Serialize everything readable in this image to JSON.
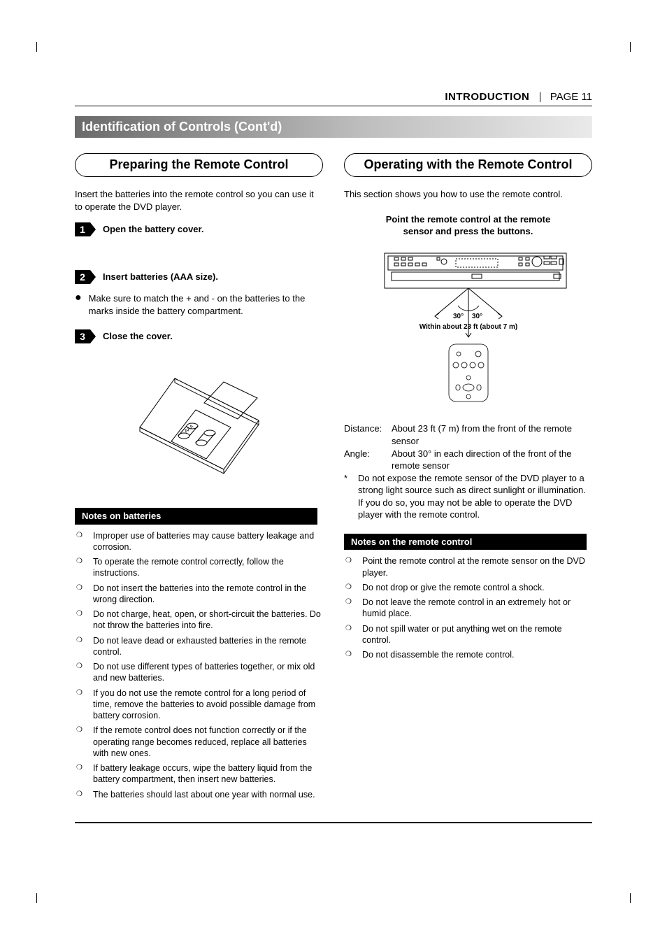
{
  "header": {
    "section": "INTRODUCTION",
    "page_label": "PAGE 11"
  },
  "titlebar": "Identification of Controls (Cont'd)",
  "left": {
    "capsule": "Preparing the Remote Control",
    "intro": "Insert the batteries into the remote control so you can use it to operate the DVD player.",
    "step1": {
      "num": "1",
      "label": "Open the battery cover."
    },
    "step2": {
      "num": "2",
      "label": "Insert batteries (AAA size)."
    },
    "step2_bullet": "Make sure to match the + and - on the batteries to the marks inside the battery compartment.",
    "step3": {
      "num": "3",
      "label": "Close the cover."
    },
    "diagram_battery_label": "AAA",
    "notes_title": "Notes on batteries",
    "notes": [
      "Improper use of batteries may cause battery leakage and corrosion.",
      "To operate the remote control correctly, follow the instructions.",
      "Do not insert the batteries into the remote control in the wrong direction.",
      "Do not charge, heat, open, or short-circuit the batteries. Do not throw the batteries into fire.",
      "Do not leave dead or exhausted batteries in the remote control.",
      "Do not use different types of batteries together, or mix old and new batteries.",
      "If you do not use the remote control for a long period of time, remove the batteries to avoid possible damage from battery corrosion.",
      "If the remote control does not function correctly or if the operating range becomes reduced, replace all batteries with new ones.",
      "If battery leakage occurs, wipe the battery liquid from the battery compartment, then insert new batteries.",
      "The batteries should last about one year with normal use."
    ]
  },
  "right": {
    "capsule": "Operating with the Remote Control",
    "intro": "This section shows you how to use the remote control.",
    "instruction": "Point the remote control at the remote sensor and press the buttons.",
    "diagram": {
      "angle_left": "30°",
      "angle_right": "30°",
      "range": "Within about 23 ft (about 7 m)"
    },
    "spec_distance_label": "Distance:",
    "spec_distance": "About 23 ft (7 m) from the front of the remote sensor",
    "spec_angle_label": "Angle:",
    "spec_angle": "About 30° in each direction of the front of the remote sensor",
    "spec_star_label": "*",
    "spec_star": "Do not expose the remote sensor of the DVD player to a strong light source such as direct sunlight or illumination. If you do so, you may not be able to operate the DVD player with the remote control.",
    "notes_title": "Notes on the remote control",
    "notes": [
      "Point the remote control at the remote sensor on the DVD player.",
      "Do not drop or give the remote control a shock.",
      "Do not leave the remote control in an extremely hot or humid place.",
      "Do not spill water or put anything wet on the remote control.",
      "Do not disassemble the remote control."
    ]
  }
}
